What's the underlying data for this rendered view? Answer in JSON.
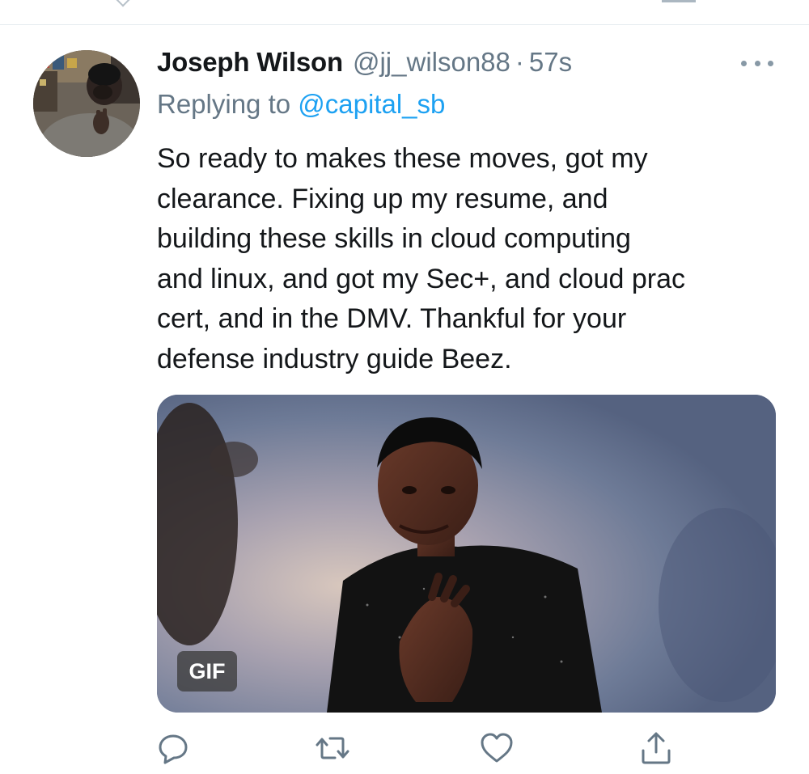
{
  "tweet": {
    "display_name": "Joseph Wilson",
    "handle": "@jj_wilson88",
    "separator": "·",
    "timestamp": "57s",
    "reply_prefix": "Replying to",
    "reply_to": "@capital_sb",
    "text_lines": [
      "So ready to makes these moves, got my",
      "clearance. Fixing up my resume, and",
      "building these skills in cloud computing",
      "and linux, and got my Sec+, and cloud prac",
      "cert, and in the DMV. Thankful for your",
      "defense industry guide Beez."
    ],
    "media": {
      "badge": "GIF"
    }
  },
  "icons": {
    "more": "more-horizontal-icon",
    "reply": "reply-bubble-icon",
    "retweet": "retweet-icon",
    "like": "heart-icon",
    "share": "share-upload-icon"
  },
  "colors": {
    "text_primary": "#14171a",
    "text_secondary": "#657786",
    "link": "#1da1f2",
    "icon": "#657786",
    "divider": "#e6ecf0"
  }
}
